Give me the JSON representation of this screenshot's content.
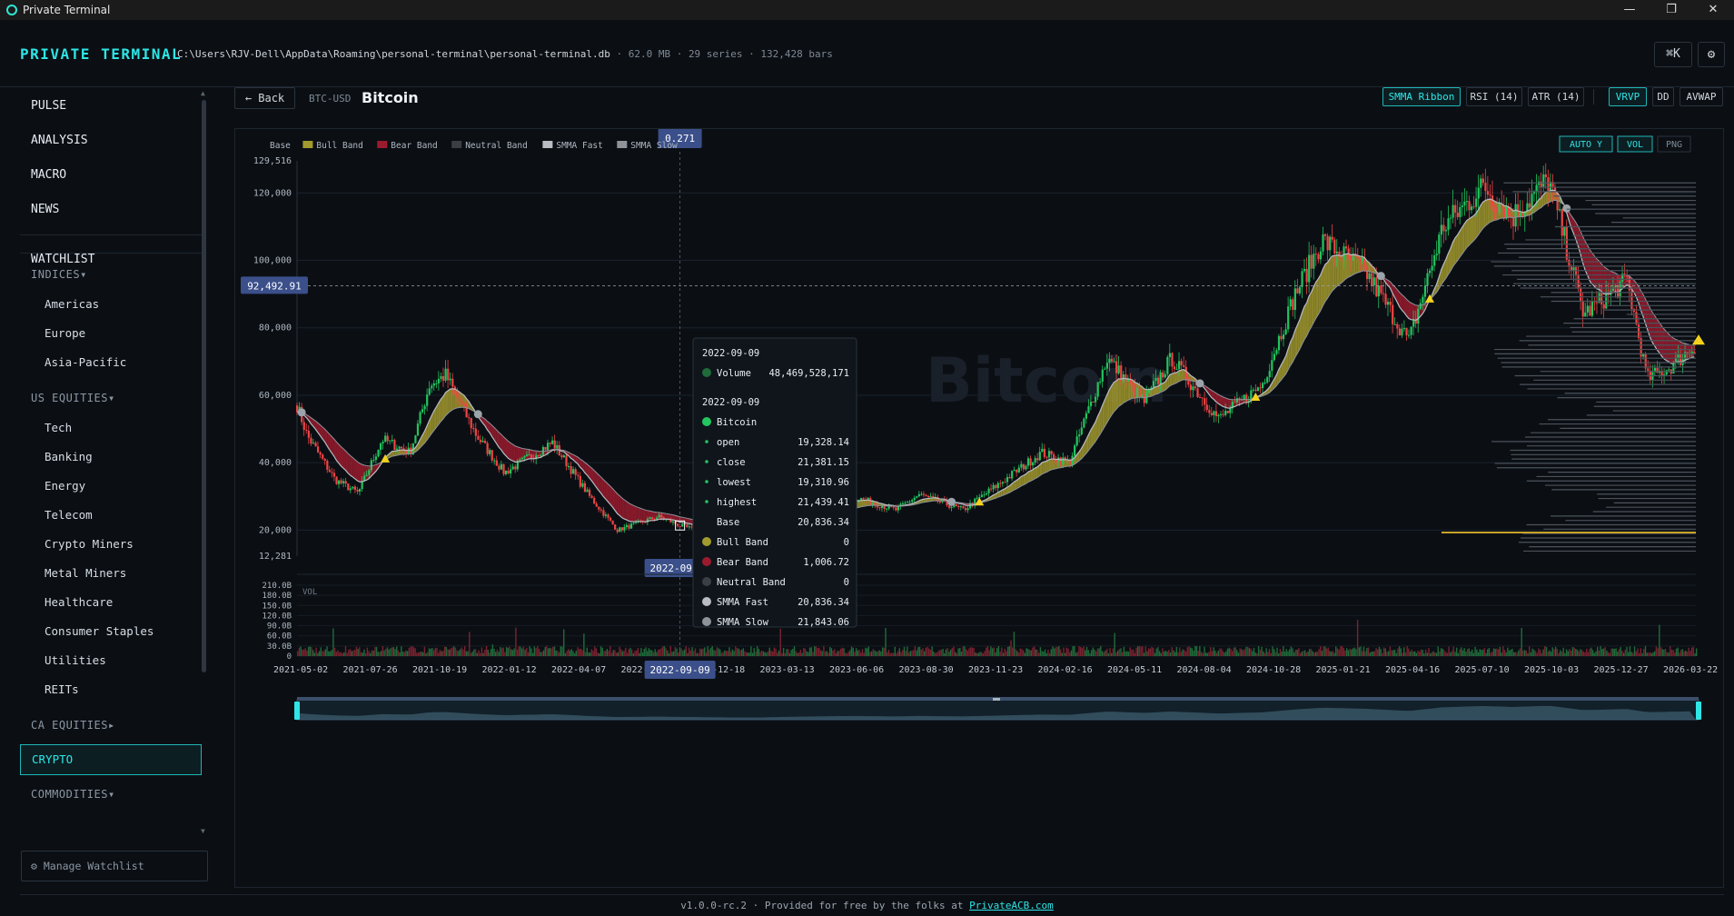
{
  "window": {
    "title": "Private Terminal",
    "buttons": [
      "—",
      "❐",
      "✕"
    ]
  },
  "header": {
    "brand": "PRIVATE TERMINAL",
    "db_path": "C:\\Users\\RJV-Dell\\AppData\\Roaming\\personal-terminal\\personal-terminal.db",
    "db_size": "62.0 MB",
    "series_count": "29 series",
    "bar_count": "132,428 bars",
    "sep": "·",
    "cmdk_label": "⌘K",
    "settings_icon": "⚙"
  },
  "sidebar": {
    "nav": [
      "PULSE",
      "ANALYSIS",
      "MACRO",
      "NEWS"
    ],
    "watchlist_label": "WATCHLIST",
    "indices_label": "INDICES▾",
    "indices": [
      "Americas",
      "Europe",
      "Asia-Pacific"
    ],
    "us_equities_label": "US EQUITIES▾",
    "us_equities": [
      "Tech",
      "Banking",
      "Energy",
      "Telecom",
      "Crypto Miners",
      "Metal Miners",
      "Healthcare",
      "Consumer Staples",
      "Utilities",
      "REITs"
    ],
    "ca_equities_label": "CA EQUITIES▸",
    "crypto_label": "CRYPTO",
    "commodities_label": "COMMODITIES▾",
    "manage_label": "⚙  Manage Watchlist"
  },
  "asset": {
    "back_label": "← Back",
    "ticker": "BTC-USD",
    "name": "Bitcoin"
  },
  "toolbar": {
    "smma": "SMMA Ribbon",
    "rsi": "RSI (14)",
    "atr": "ATR (14)",
    "vrvp": "VRVP",
    "dd": "DD",
    "avwap": "AVWAP",
    "auto_y": "AUTO Y",
    "vol": "VOL",
    "png": "PNG"
  },
  "colors": {
    "accent": "#2ee6e6",
    "up": "#22c55e",
    "down": "#ef4444",
    "bull_band": "#a39a2e",
    "bear_band": "#9b1b2e",
    "neutral_band": "#3a3f46",
    "smma_fast": "#b9bcc2",
    "smma_slow": "#8e939a",
    "crosshair_label": "#3b4f8a",
    "poc": "#c9a227"
  },
  "chart_data": {
    "type": "candlestick",
    "title": "",
    "watermark": "Bitcoin",
    "legend": [
      "Base",
      "Bull Band",
      "Bear Band",
      "Neutral Band",
      "SMMA Fast",
      "SMMA Slow"
    ],
    "y_range": [
      12281,
      129516
    ],
    "y_top_label": "129,516",
    "y_bottom_label": "12,281",
    "y_ticks": [
      20000,
      40000,
      60000,
      80000,
      100000,
      120000
    ],
    "y_tick_labels": [
      "20,000",
      "40,000",
      "60,000",
      "80,000",
      "100,000",
      "120,000"
    ],
    "last_price": 92492.91,
    "last_price_label": "92,492.91",
    "crosshair_value_label": "0.271",
    "crosshair_date": "2022-09-09",
    "x_labels": [
      "2021-05-02",
      "2021-07-26",
      "2021-10-19",
      "2022-01-12",
      "2022-04-07",
      "2022-07-0",
      "2022-12-18",
      "2023-03-13",
      "2023-06-06",
      "2023-08-30",
      "2023-11-23",
      "2024-02-16",
      "2024-05-11",
      "2024-08-04",
      "2024-10-28",
      "2025-01-21",
      "2025-04-16",
      "2025-07-10",
      "2025-10-03",
      "2025-12-27",
      "2026-03-22"
    ],
    "x_start": "2021-05-02",
    "x_end": "2026-04-14",
    "price_path": [
      [
        "2021-05-02",
        57000
      ],
      [
        "2021-05-15",
        48000
      ],
      [
        "2021-06-20",
        35000
      ],
      [
        "2021-07-20",
        31000
      ],
      [
        "2021-08-20",
        47000
      ],
      [
        "2021-09-25",
        43000
      ],
      [
        "2021-10-20",
        63000
      ],
      [
        "2021-11-10",
        66000
      ],
      [
        "2021-12-20",
        48000
      ],
      [
        "2022-01-25",
        37000
      ],
      [
        "2022-03-28",
        46000
      ],
      [
        "2022-05-15",
        30000
      ],
      [
        "2022-06-20",
        20000
      ],
      [
        "2022-08-12",
        24000
      ],
      [
        "2022-09-09",
        21381
      ],
      [
        "2022-11-20",
        16300
      ],
      [
        "2022-12-25",
        16800
      ],
      [
        "2023-01-31",
        23000
      ],
      [
        "2023-03-20",
        28000
      ],
      [
        "2023-04-20",
        30000
      ],
      [
        "2023-06-15",
        26000
      ],
      [
        "2023-07-15",
        30500
      ],
      [
        "2023-09-10",
        26000
      ],
      [
        "2023-10-31",
        34500
      ],
      [
        "2023-12-20",
        43000
      ],
      [
        "2024-01-25",
        40000
      ],
      [
        "2024-03-14",
        71000
      ],
      [
        "2024-05-01",
        58000
      ],
      [
        "2024-06-05",
        71000
      ],
      [
        "2024-08-05",
        53000
      ],
      [
        "2024-09-30",
        63000
      ],
      [
        "2024-11-12",
        90000
      ],
      [
        "2024-12-17",
        106000
      ],
      [
        "2025-02-10",
        97000
      ],
      [
        "2025-04-08",
        76000
      ],
      [
        "2025-05-22",
        110000
      ],
      [
        "2025-07-14",
        122000
      ],
      [
        "2025-08-20",
        113000
      ],
      [
        "2025-10-06",
        124000
      ],
      [
        "2025-11-20",
        84000
      ],
      [
        "2026-01-15",
        94000
      ],
      [
        "2026-02-10",
        65000
      ],
      [
        "2026-03-10",
        68000
      ],
      [
        "2026-04-14",
        75000
      ]
    ],
    "volume_axis": {
      "labels": [
        "210.0B",
        "180.0B",
        "150.0B",
        "120.0B",
        "90.0B",
        "60.0B",
        "30.0B",
        "0"
      ],
      "max": 210
    },
    "vol_label": "VOL",
    "tooltip": {
      "date1": "2022-09-09",
      "rows1": [
        {
          "label": "Volume",
          "value": "48,469,528,171"
        }
      ],
      "date2": "2022-09-09",
      "rows2": [
        {
          "label": "Bitcoin",
          "value": ""
        },
        {
          "label": "open",
          "value": "19,328.14"
        },
        {
          "label": "close",
          "value": "21,381.15"
        },
        {
          "label": "lowest",
          "value": "19,310.96"
        },
        {
          "label": "highest",
          "value": "21,439.41"
        },
        {
          "label": "Base",
          "value": "20,836.34"
        },
        {
          "label": "Bull Band",
          "value": "0"
        },
        {
          "label": "Bear Band",
          "value": "1,006.72"
        },
        {
          "label": "Neutral Band",
          "value": "0"
        },
        {
          "label": "SMMA Fast",
          "value": "20,836.34"
        },
        {
          "label": "SMMA Slow",
          "value": "21,843.06"
        }
      ]
    }
  },
  "footer": {
    "text": "v1.0.0-rc.2 · Provided for free by the folks at ",
    "link": "PrivateACB.com"
  }
}
